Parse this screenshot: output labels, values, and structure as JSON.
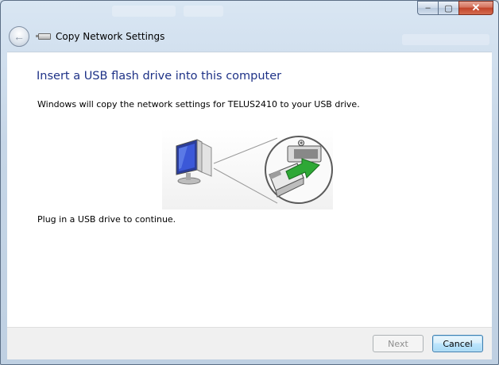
{
  "window": {
    "title": "Copy Network Settings",
    "caption_buttons": {
      "minimize": "–",
      "maximize": "▢",
      "close": "✕"
    }
  },
  "nav": {
    "back_icon": "back-arrow-icon"
  },
  "main": {
    "heading": "Insert a USB flash drive into this computer",
    "description": "Windows will copy the network settings for TELUS2410 to your USB drive.",
    "instruction": "Plug in a USB drive to continue."
  },
  "footer": {
    "next_label": "Next",
    "cancel_label": "Cancel"
  },
  "colors": {
    "heading": "#1e3287",
    "arrow": "#2ea836",
    "cancel_border": "#3c7fb1"
  }
}
